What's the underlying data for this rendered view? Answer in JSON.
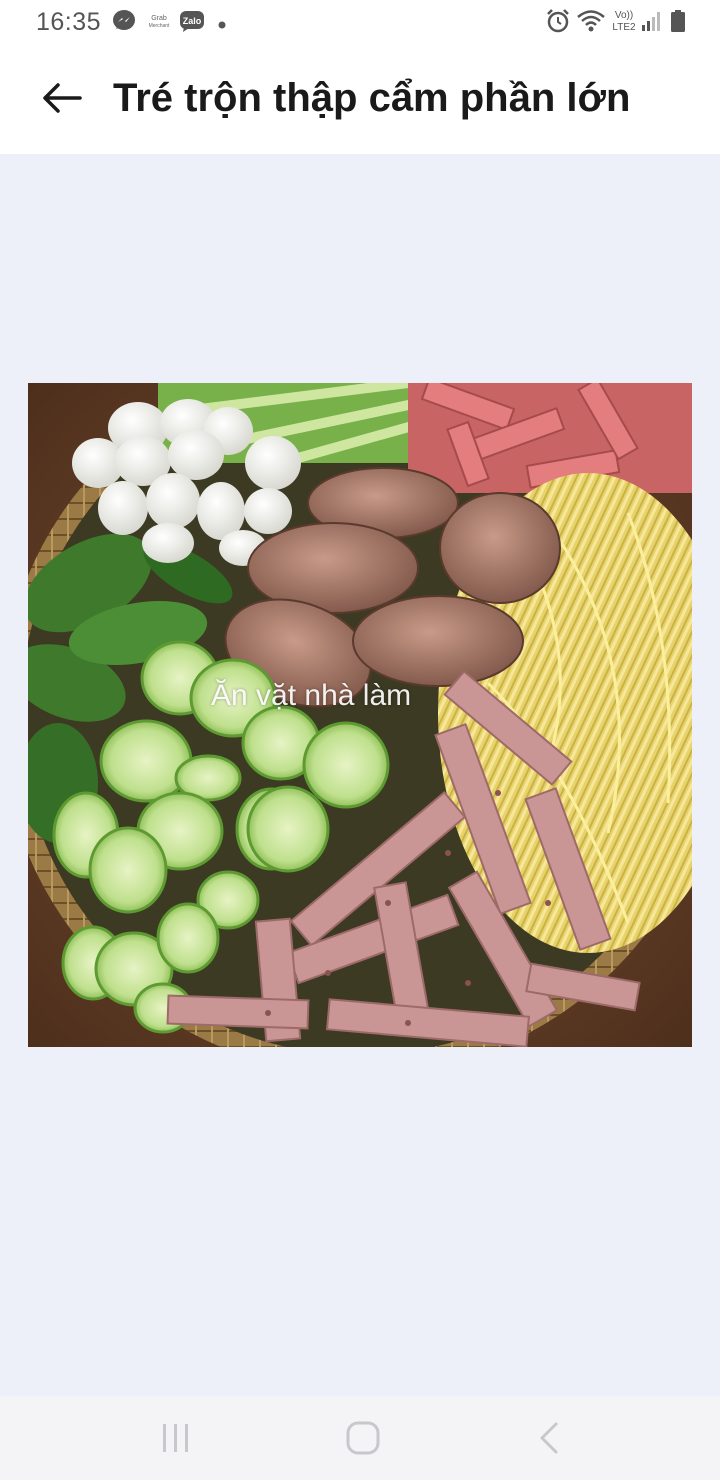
{
  "status_bar": {
    "time": "16:35",
    "notification_icons": [
      "messenger-icon",
      "grab-merchant-icon",
      "zalo-icon",
      "dot-icon"
    ],
    "grab_text": "Grab Merchant",
    "zalo_text": "Zalo",
    "system_icons": [
      "alarm-icon",
      "wifi-icon",
      "volte-lte2-icon",
      "signal-icon",
      "battery-icon"
    ],
    "network_text_top": "Vo))",
    "network_text_bottom": "LTE2"
  },
  "header": {
    "title": "Tré trộn thập cẩm phần lớn",
    "back_icon": "arrow-left-icon"
  },
  "photo": {
    "watermark": "Ăn vặt nhà làm",
    "subject": "food-platter-image"
  },
  "nav_bar": {
    "items": [
      "recent-apps-icon",
      "home-icon",
      "back-icon"
    ]
  },
  "colors": {
    "background": "#eef0f9",
    "header": "#ffffff",
    "title": "#1a1a1a",
    "nav_icons": "#c8c8cc"
  }
}
